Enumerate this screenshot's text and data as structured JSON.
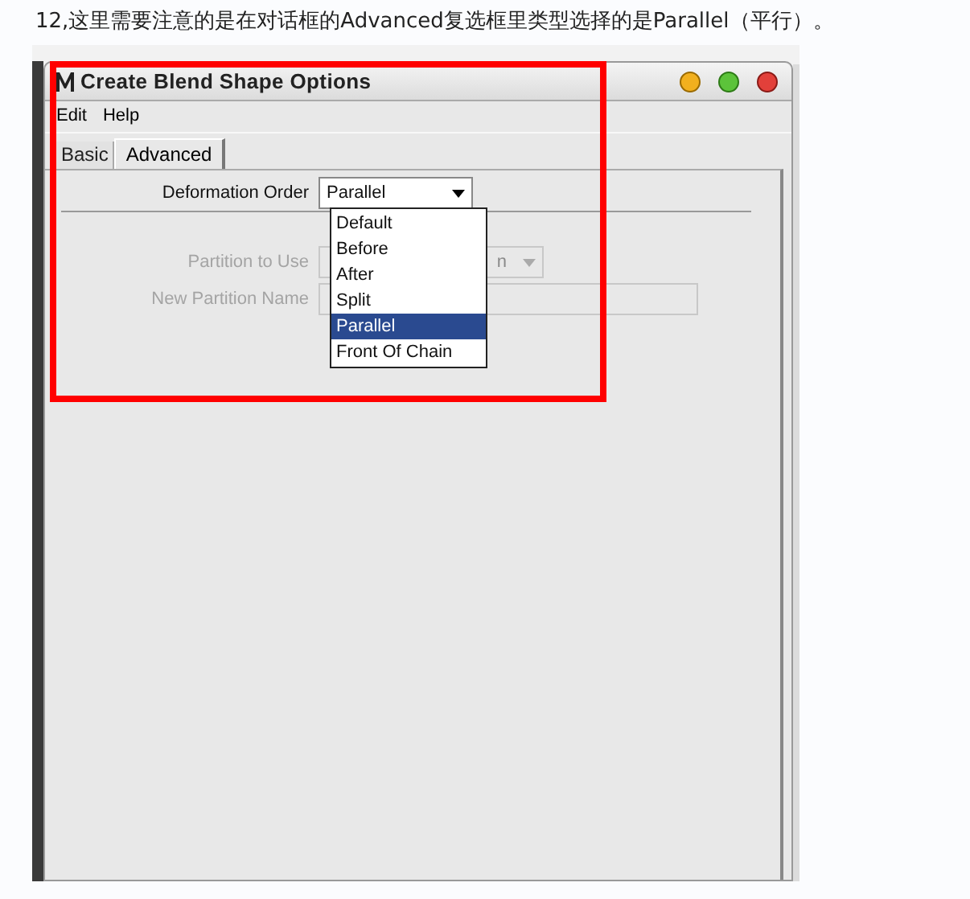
{
  "caption": "12,这里需要注意的是在对话框的Advanced复选框里类型选择的是Parallel（平行）。",
  "window": {
    "title": "Create Blend Shape Options"
  },
  "menu": [
    "Edit",
    "Help"
  ],
  "tabs": [
    {
      "label": "Basic",
      "selected": false
    },
    {
      "label": "Advanced",
      "selected": true
    }
  ],
  "fields": [
    {
      "kind": "dropdown",
      "label": "Deformation Order",
      "value": "Parallel",
      "disabled": false
    },
    {
      "kind": "dropdown",
      "label": "Partition to Use",
      "value": "n",
      "disabled": true
    },
    {
      "kind": "text",
      "label": "New Partition Name",
      "disabled": true
    }
  ],
  "dropdown_list": [
    {
      "label": "Default",
      "selected": false
    },
    {
      "label": "Before",
      "selected": false
    },
    {
      "label": "After",
      "selected": false
    },
    {
      "label": "Split",
      "selected": false
    },
    {
      "label": "Parallel",
      "selected": true
    },
    {
      "label": "Front Of Chain",
      "selected": false
    }
  ]
}
